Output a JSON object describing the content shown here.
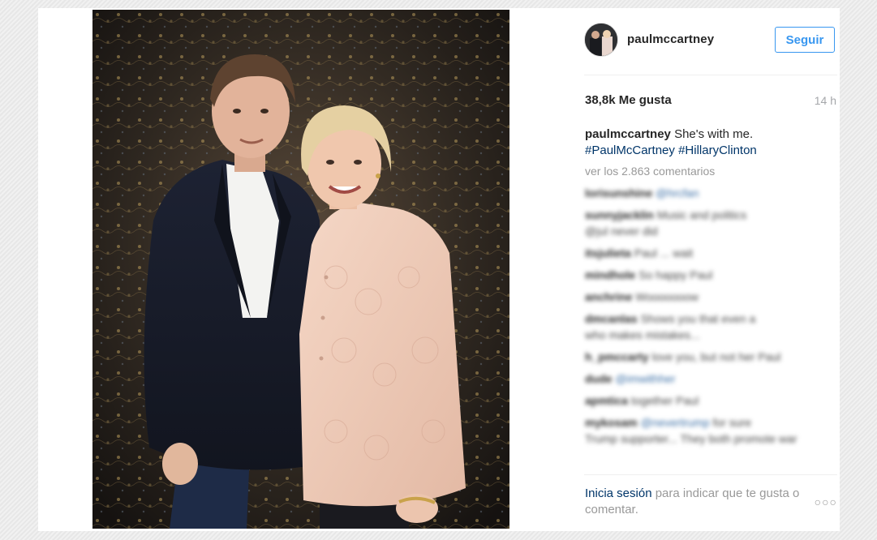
{
  "post": {
    "username": "paulmccartney",
    "follow_label": "Seguir",
    "likes": "38,8k Me gusta",
    "time": "14 h",
    "caption_user": "paulmccartney",
    "caption_text": "She's with me.",
    "hashtags": [
      "#PaulMcCartney",
      "#HillaryClinton"
    ],
    "view_comments": "ver los 2.863 comentarios",
    "login_link": "Inicia sesión",
    "login_text": "para indicar que te gusta o comentar.",
    "more_icon": "ellipsis-icon"
  },
  "comments": [
    {
      "user": "lorisunshine",
      "text": "",
      "hashtag": "@hrcfan"
    },
    {
      "user": "sunnyjacklin",
      "text": "Music and politics",
      "hashtag": ""
    },
    {
      "user": "",
      "text": "@jul never did",
      "hashtag": ""
    },
    {
      "user": "itsjulieta",
      "text": "Paul ... wait",
      "hashtag": ""
    },
    {
      "user": "mindhole",
      "text": "So happy Paul",
      "hashtag": ""
    },
    {
      "user": "anchrine",
      "text": "Wooooooow",
      "hashtag": ""
    },
    {
      "user": "dmcanlas",
      "text": "Shows you that even a",
      "hashtag": ""
    },
    {
      "user": "",
      "text": "who makes mistakes...",
      "hashtag": ""
    },
    {
      "user": "h_pmccarty",
      "text": "love you, but not her Paul",
      "hashtag": ""
    },
    {
      "user": "dude",
      "text": "",
      "hashtag": "@imwithher"
    },
    {
      "user": "apmtica",
      "text": "together Paul",
      "hashtag": ""
    },
    {
      "user": "mykosam",
      "text": "for sure",
      "hashtag": "@nevertrump"
    },
    {
      "user": "",
      "text": "Trump supporter... They both promote war",
      "hashtag": ""
    }
  ]
}
